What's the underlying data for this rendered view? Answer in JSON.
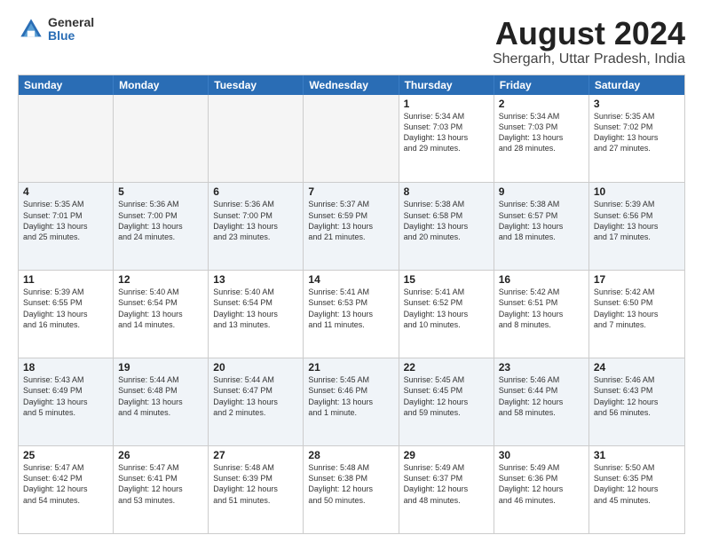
{
  "header": {
    "logo_general": "General",
    "logo_blue": "Blue",
    "title": "August 2024",
    "location": "Shergarh, Uttar Pradesh, India"
  },
  "calendar": {
    "days_of_week": [
      "Sunday",
      "Monday",
      "Tuesday",
      "Wednesday",
      "Thursday",
      "Friday",
      "Saturday"
    ],
    "weeks": [
      [
        {
          "day": "",
          "empty": true
        },
        {
          "day": "",
          "empty": true
        },
        {
          "day": "",
          "empty": true
        },
        {
          "day": "",
          "empty": true
        },
        {
          "day": "1",
          "line1": "Sunrise: 5:34 AM",
          "line2": "Sunset: 7:03 PM",
          "line3": "Daylight: 13 hours",
          "line4": "and 29 minutes."
        },
        {
          "day": "2",
          "line1": "Sunrise: 5:34 AM",
          "line2": "Sunset: 7:03 PM",
          "line3": "Daylight: 13 hours",
          "line4": "and 28 minutes."
        },
        {
          "day": "3",
          "line1": "Sunrise: 5:35 AM",
          "line2": "Sunset: 7:02 PM",
          "line3": "Daylight: 13 hours",
          "line4": "and 27 minutes."
        }
      ],
      [
        {
          "day": "4",
          "line1": "Sunrise: 5:35 AM",
          "line2": "Sunset: 7:01 PM",
          "line3": "Daylight: 13 hours",
          "line4": "and 25 minutes."
        },
        {
          "day": "5",
          "line1": "Sunrise: 5:36 AM",
          "line2": "Sunset: 7:00 PM",
          "line3": "Daylight: 13 hours",
          "line4": "and 24 minutes."
        },
        {
          "day": "6",
          "line1": "Sunrise: 5:36 AM",
          "line2": "Sunset: 7:00 PM",
          "line3": "Daylight: 13 hours",
          "line4": "and 23 minutes."
        },
        {
          "day": "7",
          "line1": "Sunrise: 5:37 AM",
          "line2": "Sunset: 6:59 PM",
          "line3": "Daylight: 13 hours",
          "line4": "and 21 minutes."
        },
        {
          "day": "8",
          "line1": "Sunrise: 5:38 AM",
          "line2": "Sunset: 6:58 PM",
          "line3": "Daylight: 13 hours",
          "line4": "and 20 minutes."
        },
        {
          "day": "9",
          "line1": "Sunrise: 5:38 AM",
          "line2": "Sunset: 6:57 PM",
          "line3": "Daylight: 13 hours",
          "line4": "and 18 minutes."
        },
        {
          "day": "10",
          "line1": "Sunrise: 5:39 AM",
          "line2": "Sunset: 6:56 PM",
          "line3": "Daylight: 13 hours",
          "line4": "and 17 minutes."
        }
      ],
      [
        {
          "day": "11",
          "line1": "Sunrise: 5:39 AM",
          "line2": "Sunset: 6:55 PM",
          "line3": "Daylight: 13 hours",
          "line4": "and 16 minutes."
        },
        {
          "day": "12",
          "line1": "Sunrise: 5:40 AM",
          "line2": "Sunset: 6:54 PM",
          "line3": "Daylight: 13 hours",
          "line4": "and 14 minutes."
        },
        {
          "day": "13",
          "line1": "Sunrise: 5:40 AM",
          "line2": "Sunset: 6:54 PM",
          "line3": "Daylight: 13 hours",
          "line4": "and 13 minutes."
        },
        {
          "day": "14",
          "line1": "Sunrise: 5:41 AM",
          "line2": "Sunset: 6:53 PM",
          "line3": "Daylight: 13 hours",
          "line4": "and 11 minutes."
        },
        {
          "day": "15",
          "line1": "Sunrise: 5:41 AM",
          "line2": "Sunset: 6:52 PM",
          "line3": "Daylight: 13 hours",
          "line4": "and 10 minutes."
        },
        {
          "day": "16",
          "line1": "Sunrise: 5:42 AM",
          "line2": "Sunset: 6:51 PM",
          "line3": "Daylight: 13 hours",
          "line4": "and 8 minutes."
        },
        {
          "day": "17",
          "line1": "Sunrise: 5:42 AM",
          "line2": "Sunset: 6:50 PM",
          "line3": "Daylight: 13 hours",
          "line4": "and 7 minutes."
        }
      ],
      [
        {
          "day": "18",
          "line1": "Sunrise: 5:43 AM",
          "line2": "Sunset: 6:49 PM",
          "line3": "Daylight: 13 hours",
          "line4": "and 5 minutes."
        },
        {
          "day": "19",
          "line1": "Sunrise: 5:44 AM",
          "line2": "Sunset: 6:48 PM",
          "line3": "Daylight: 13 hours",
          "line4": "and 4 minutes."
        },
        {
          "day": "20",
          "line1": "Sunrise: 5:44 AM",
          "line2": "Sunset: 6:47 PM",
          "line3": "Daylight: 13 hours",
          "line4": "and 2 minutes."
        },
        {
          "day": "21",
          "line1": "Sunrise: 5:45 AM",
          "line2": "Sunset: 6:46 PM",
          "line3": "Daylight: 13 hours",
          "line4": "and 1 minute."
        },
        {
          "day": "22",
          "line1": "Sunrise: 5:45 AM",
          "line2": "Sunset: 6:45 PM",
          "line3": "Daylight: 12 hours",
          "line4": "and 59 minutes."
        },
        {
          "day": "23",
          "line1": "Sunrise: 5:46 AM",
          "line2": "Sunset: 6:44 PM",
          "line3": "Daylight: 12 hours",
          "line4": "and 58 minutes."
        },
        {
          "day": "24",
          "line1": "Sunrise: 5:46 AM",
          "line2": "Sunset: 6:43 PM",
          "line3": "Daylight: 12 hours",
          "line4": "and 56 minutes."
        }
      ],
      [
        {
          "day": "25",
          "line1": "Sunrise: 5:47 AM",
          "line2": "Sunset: 6:42 PM",
          "line3": "Daylight: 12 hours",
          "line4": "and 54 minutes."
        },
        {
          "day": "26",
          "line1": "Sunrise: 5:47 AM",
          "line2": "Sunset: 6:41 PM",
          "line3": "Daylight: 12 hours",
          "line4": "and 53 minutes."
        },
        {
          "day": "27",
          "line1": "Sunrise: 5:48 AM",
          "line2": "Sunset: 6:39 PM",
          "line3": "Daylight: 12 hours",
          "line4": "and 51 minutes."
        },
        {
          "day": "28",
          "line1": "Sunrise: 5:48 AM",
          "line2": "Sunset: 6:38 PM",
          "line3": "Daylight: 12 hours",
          "line4": "and 50 minutes."
        },
        {
          "day": "29",
          "line1": "Sunrise: 5:49 AM",
          "line2": "Sunset: 6:37 PM",
          "line3": "Daylight: 12 hours",
          "line4": "and 48 minutes."
        },
        {
          "day": "30",
          "line1": "Sunrise: 5:49 AM",
          "line2": "Sunset: 6:36 PM",
          "line3": "Daylight: 12 hours",
          "line4": "and 46 minutes."
        },
        {
          "day": "31",
          "line1": "Sunrise: 5:50 AM",
          "line2": "Sunset: 6:35 PM",
          "line3": "Daylight: 12 hours",
          "line4": "and 45 minutes."
        }
      ]
    ]
  }
}
